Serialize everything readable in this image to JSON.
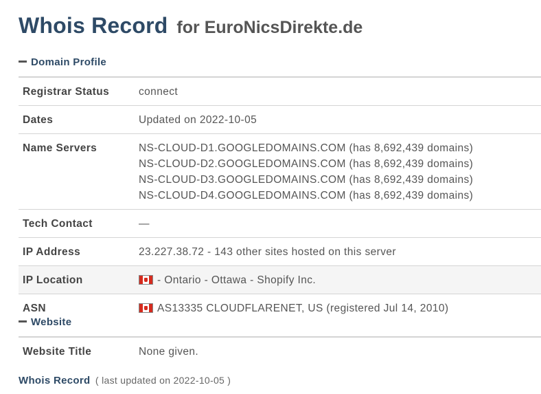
{
  "header": {
    "title": "Whois Record",
    "subtitle": "for EuroNicsDirekte.de"
  },
  "domain_profile": {
    "heading": "Domain Profile",
    "registrar_status": {
      "label": "Registrar Status",
      "value": "connect"
    },
    "dates": {
      "label": "Dates",
      "value": "Updated on 2022-10-05"
    },
    "name_servers": {
      "label": "Name Servers",
      "values": [
        "NS-CLOUD-D1.GOOGLEDOMAINS.COM (has 8,692,439 domains)",
        "NS-CLOUD-D2.GOOGLEDOMAINS.COM (has 8,692,439 domains)",
        "NS-CLOUD-D3.GOOGLEDOMAINS.COM (has 8,692,439 domains)",
        "NS-CLOUD-D4.GOOGLEDOMAINS.COM (has 8,692,439 domains)"
      ]
    },
    "tech_contact": {
      "label": "Tech Contact",
      "value": "—"
    },
    "ip_address": {
      "label": "IP Address",
      "value": "23.227.38.72 - 143 other sites hosted on this server"
    },
    "ip_location": {
      "label": "IP Location",
      "value": "- Ontario - Ottawa - Shopify Inc.",
      "flag_icon": "canada-flag-icon"
    },
    "asn": {
      "label": "ASN",
      "value": "AS13335 CLOUDFLARENET, US (registered Jul 14, 2010)",
      "flag_icon": "canada-flag-icon"
    }
  },
  "website": {
    "heading": "Website",
    "website_title": {
      "label": "Website Title",
      "value": "None given."
    }
  },
  "footer": {
    "link": "Whois Record",
    "note": "( last updated on 2022-10-05 )"
  },
  "colors": {
    "heading_blue": "#2e4a66",
    "flag_red": "#d52b1e",
    "row_shade": "#f5f5f5"
  }
}
